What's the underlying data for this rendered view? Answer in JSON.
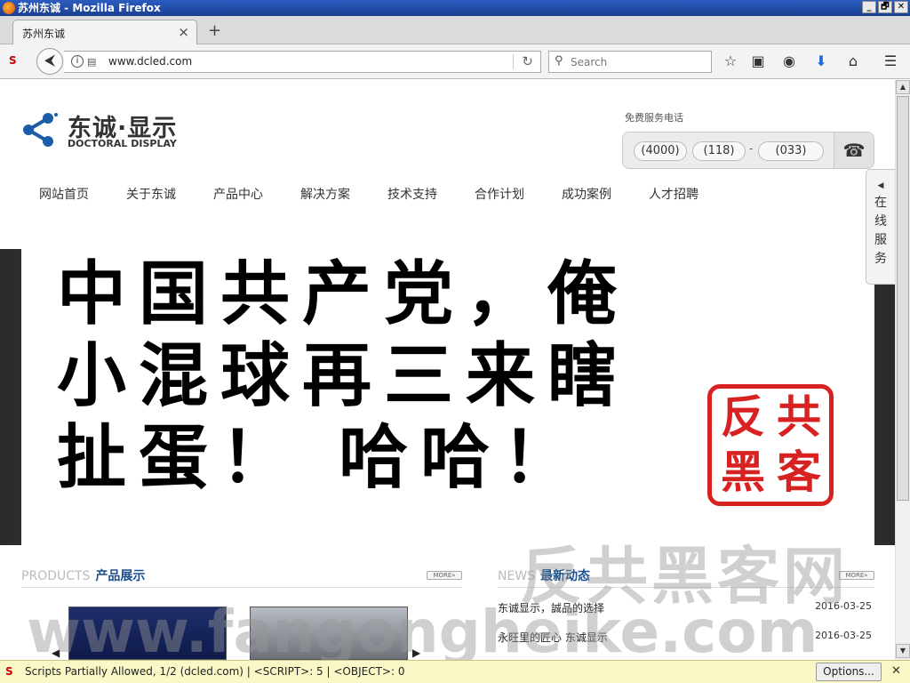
{
  "window": {
    "title": "苏州东诚 - Mozilla Firefox",
    "min": "_",
    "restore": "🗗",
    "close": "✕"
  },
  "tab": {
    "label": "苏州东诚",
    "close": "×",
    "new": "+"
  },
  "navbar": {
    "url": "www.dcled.com",
    "search_placeholder": "Search",
    "back": "⮜",
    "reload": "↻"
  },
  "site": {
    "logo_cn": "东诚·显示",
    "logo_en": "DOCTORAL DISPLAY",
    "hotline_label": "免费服务电话",
    "phone": {
      "part1": "(4000)",
      "part2": "(118)",
      "dash": "-",
      "part3": "(033)",
      "icon": "☎"
    },
    "nav": [
      "网站首页",
      "关于东诚",
      "产品中心",
      "解决方案",
      "技术支持",
      "合作计划",
      "成功案例",
      "人才招聘"
    ],
    "service_tab": {
      "arrow": "◀",
      "chars": [
        "在",
        "线",
        "服",
        "务"
      ]
    },
    "banner": {
      "lines": [
        "中国共产党，俺",
        "小混球再三来瞎",
        "扯蛋！ 哈哈！"
      ],
      "seal": [
        "反",
        "共",
        "黑",
        "客"
      ]
    },
    "products": {
      "en": "PRODUCTS",
      "cn": "产品展示",
      "more": "MORE»"
    },
    "news": {
      "en": "NEWS",
      "cn": "最新动态",
      "more": "MORE»",
      "items": [
        {
          "title": "东诚显示，誠品的选择",
          "date": "2016-03-25"
        },
        {
          "title": "永旺里的匠心 东诚显示",
          "date": "2016-03-25"
        }
      ]
    },
    "watermark": {
      "cn": "反共黑客网",
      "url": "www.fangongheike.com"
    }
  },
  "statusbar": {
    "message": "Scripts Partially Allowed, 1/2 (dcled.com) | <SCRIPT>: 5 | <OBJECT>: 0",
    "options": "Options...",
    "close": "✕"
  },
  "colors": {
    "accent": "#1a4e8c",
    "seal_red": "#d82222",
    "status_bg": "#fbf8c8"
  }
}
